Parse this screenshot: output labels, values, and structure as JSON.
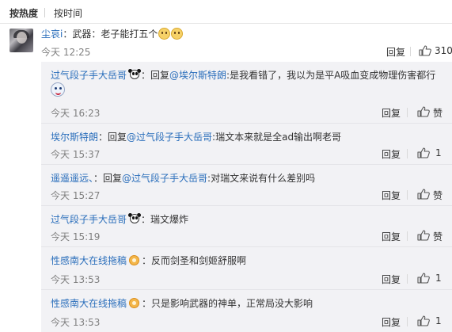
{
  "sort": {
    "hot_label": "按热度",
    "time_label": "按时间"
  },
  "main_comment": {
    "user": "尘哀i",
    "colon": "：",
    "text": "武器：老子能打五个",
    "time": "今天 12:25",
    "reply_label": "回复",
    "like_count": "310"
  },
  "replies": [
    {
      "user": "过气段子手大岳哥",
      "prefix": "：回复",
      "target": "@埃尔斯特朗",
      "text": ":是我看错了，我以为是平A吸血变成物理伤害都行",
      "time": "今天 16:23",
      "reply_label": "回复",
      "like_label": "赞"
    },
    {
      "user": "埃尔斯特朗",
      "prefix": "：回复",
      "target": "@过气段子手大岳哥",
      "text": ":瑞文本来就是全ad输出啊老哥",
      "time": "今天 15:37",
      "reply_label": "回复",
      "like_count": "1"
    },
    {
      "user": "遥遥遥远、",
      "prefix": "：回复",
      "target": "@过气段子手大岳哥",
      "text": ":对瑞文来说有什么差别吗",
      "time": "今天 15:27",
      "reply_label": "回复",
      "like_label": "赞"
    },
    {
      "user": "过气段子手大岳哥",
      "prefix": "：",
      "target": "",
      "text": "瑞文爆炸",
      "time": "今天 15:19",
      "reply_label": "回复",
      "like_label": "赞"
    },
    {
      "user": "性感南大在线拖稿",
      "prefix": "：",
      "target": "",
      "text": "反而剑圣和剑姬舒服啊",
      "time": "今天 13:53",
      "reply_label": "回复",
      "like_count": "1"
    },
    {
      "user": "性感南大在线拖稿",
      "prefix": "：",
      "target": "",
      "text": "只是影响武器的神单，正常局没大影响",
      "time": "今天 13:53",
      "reply_label": "回复",
      "like_count": "1"
    }
  ],
  "colors": {
    "link": "#2a6ebb",
    "muted": "#808080",
    "reply_bg": "#f2f2f5"
  }
}
